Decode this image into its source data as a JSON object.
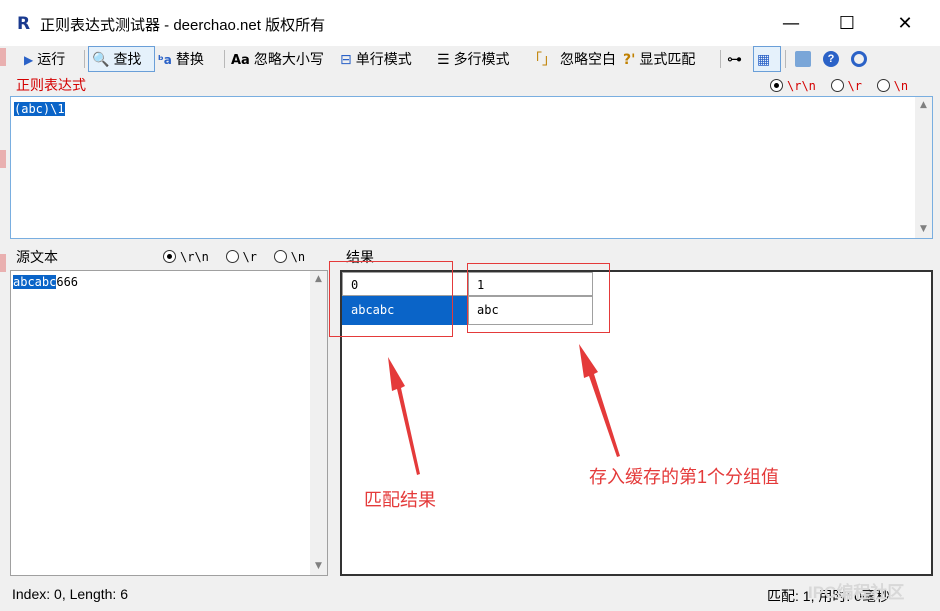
{
  "window": {
    "title": "正则表达式测试器 - deerchao.net 版权所有",
    "app_icon": "R",
    "min_glyph": "—",
    "max_glyph": "☐",
    "close_glyph": "✕"
  },
  "toolbar": {
    "run": "运行",
    "find": "查找",
    "replace": "替换",
    "ignore_case": "忽略大小写",
    "single_line": "单行模式",
    "multi_line": "多行模式",
    "ignore_space": "忽略空白",
    "explicit_capture": "显式匹配"
  },
  "regex": {
    "label": "正则表达式",
    "value": "(abc)\\1",
    "newline_options": [
      "\\r\\n",
      "\\r",
      "\\n"
    ],
    "selected_newline": "\\r\\n"
  },
  "source": {
    "label": "源文本",
    "selected_text": "abcabc",
    "rest_text": "666",
    "newline_options": [
      "\\r\\n",
      "\\r",
      "\\n"
    ]
  },
  "results": {
    "label": "结果",
    "columns": [
      "0",
      "1"
    ],
    "rows": [
      [
        "abcabc",
        "abc"
      ]
    ]
  },
  "annotations": {
    "match_result": "匹配结果",
    "group_value": "存入缓存的第1个分组值",
    "color": "#e43a3a"
  },
  "status": {
    "index_length": "Index: 0, Length: 6",
    "match_count": "匹配:   1, 用时: 0毫秒"
  },
  "watermark": "IPC编程社区"
}
